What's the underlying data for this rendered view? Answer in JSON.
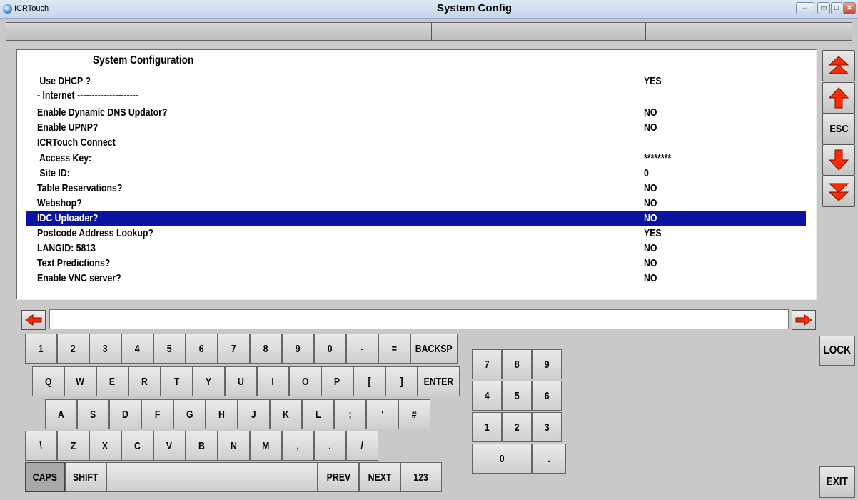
{
  "window": {
    "title": "ICRTouch"
  },
  "header": {
    "title": "System Config"
  },
  "panel": {
    "title": "System Configuration",
    "rows": [
      {
        "label": " Use DHCP ?",
        "value": "YES"
      },
      {
        "label": "- Internet ---------------------",
        "value": ""
      },
      {
        "label": "Enable Dynamic DNS Updator?",
        "value": "NO"
      },
      {
        "label": "Enable UPNP?",
        "value": "NO"
      },
      {
        "label": "ICRTouch Connect",
        "value": ""
      },
      {
        "label": " Access Key:",
        "value": "********"
      },
      {
        "label": " Site ID:",
        "value": "0"
      },
      {
        "label": "Table Reservations?",
        "value": "NO"
      },
      {
        "label": "Webshop?",
        "value": "NO"
      },
      {
        "label": "IDC Uploader?",
        "value": "NO"
      },
      {
        "label": "Postcode Address Lookup?",
        "value": "YES"
      },
      {
        "label": "LANGID: 5813",
        "value": "NO"
      },
      {
        "label": "Text Predictions?",
        "value": "NO"
      },
      {
        "label": "Enable VNC server?",
        "value": "NO"
      }
    ],
    "selected_row": 9
  },
  "side_buttons": {
    "esc": "ESC",
    "lock": "LOCK",
    "exit": "EXIT"
  },
  "input": {
    "value": ""
  },
  "keyboard": {
    "row1": [
      "1",
      "2",
      "3",
      "4",
      "5",
      "6",
      "7",
      "8",
      "9",
      "0",
      "-",
      "=",
      "BACKSP"
    ],
    "row2": [
      "Q",
      "W",
      "E",
      "R",
      "T",
      "Y",
      "U",
      "I",
      "O",
      "P",
      "[",
      "]",
      "ENTER"
    ],
    "row3": [
      "A",
      "S",
      "D",
      "F",
      "G",
      "H",
      "J",
      "K",
      "L",
      ";",
      "'",
      "#"
    ],
    "row4": [
      "\\",
      "Z",
      "X",
      "C",
      "V",
      "B",
      "N",
      "M",
      ",",
      ".",
      "/"
    ],
    "bottom": {
      "caps": "CAPS",
      "shift": "SHIFT",
      "space": "",
      "prev": "PREV",
      "next": "NEXT",
      "num": "123"
    }
  },
  "numpad": {
    "row1": [
      "7",
      "8",
      "9"
    ],
    "row2": [
      "4",
      "5",
      "6"
    ],
    "row3": [
      "1",
      "2",
      "3"
    ],
    "zero": "0",
    "dot": "."
  },
  "colors": {
    "selection": "#0a14a0",
    "arrow": "#ff2a00",
    "background": "#c9c9c9"
  }
}
